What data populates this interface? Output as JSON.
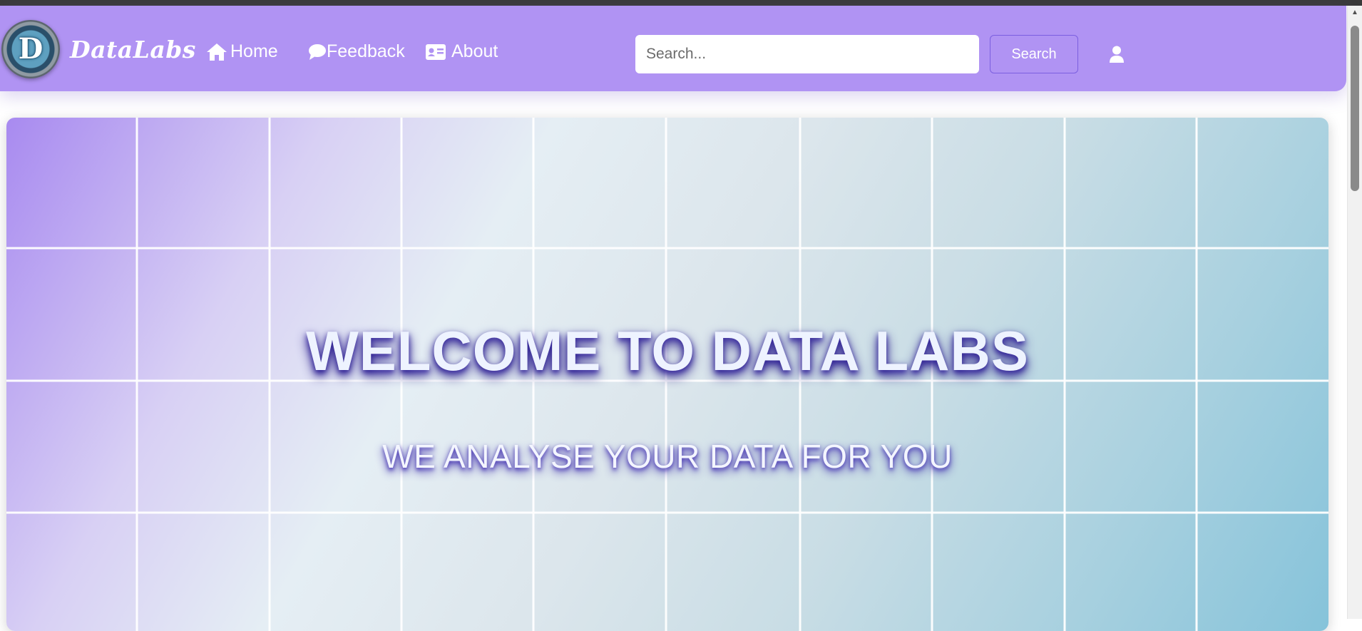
{
  "colors": {
    "navbar": "#b093f3",
    "hero_gradient_start": "#a88af0",
    "hero_gradient_end": "#86c3da",
    "accent_border": "#7b5fe0"
  },
  "navbar": {
    "logo_letter": "D",
    "brand": "DataLabs",
    "links": [
      {
        "label": "Home",
        "icon": "home-icon"
      },
      {
        "label": "Feedback",
        "icon": "comment-icon"
      },
      {
        "label": "About",
        "icon": "id-card-icon"
      }
    ],
    "search": {
      "placeholder": "Search...",
      "value": "",
      "button_label": "Search"
    },
    "user_icon": "user-icon"
  },
  "hero": {
    "title": "WELCOME TO DATA LABS",
    "subtitle": "WE ANALYSE YOUR DATA FOR YOU"
  }
}
